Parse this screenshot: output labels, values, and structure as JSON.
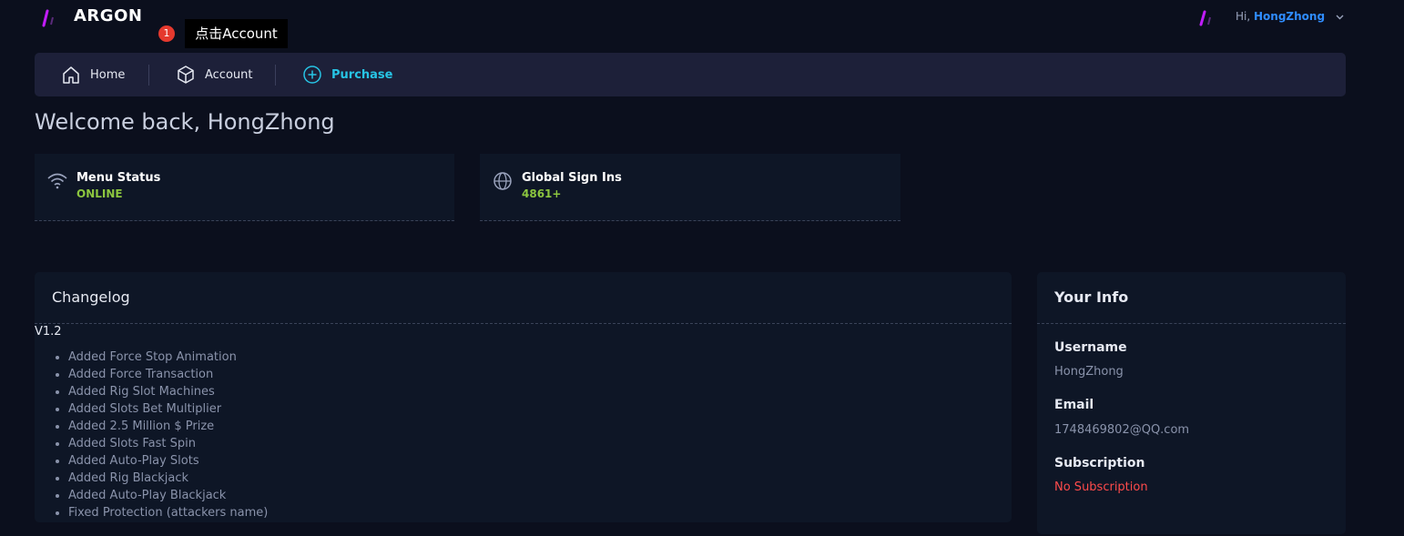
{
  "app": {
    "brand": "ARGON"
  },
  "annotation": {
    "step": "1",
    "text": "点击Account"
  },
  "user": {
    "greeting": "Hi,",
    "name": "HongZhong"
  },
  "nav": {
    "items": [
      {
        "label": "Home",
        "icon": "home-icon"
      },
      {
        "label": "Account",
        "icon": "cube-icon"
      },
      {
        "label": "Purchase",
        "icon": "plus-circle-icon",
        "active": true
      }
    ]
  },
  "welcome": "Welcome back, HongZhong",
  "stats": [
    {
      "title": "Menu Status",
      "value": "ONLINE",
      "icon": "wifi-icon"
    },
    {
      "title": "Global Sign Ins",
      "value": "4861+",
      "icon": "globe-icon"
    }
  ],
  "changelog": {
    "title": "Changelog",
    "version": "V1.2",
    "entries": [
      "Added Force Stop Animation",
      "Added Force Transaction",
      "Added Rig Slot Machines",
      "Added Slots Bet Multiplier",
      "Added 2.5 Million $ Prize",
      "Added Slots Fast Spin",
      "Added Auto-Play Slots",
      "Added Rig Blackjack",
      "Added Auto-Play Blackjack",
      "Fixed Protection (attackers name)"
    ]
  },
  "info": {
    "title": "Your Info",
    "username_label": "Username",
    "username": "HongZhong",
    "email_label": "Email",
    "email": "1748469802@QQ.com",
    "subscription_label": "Subscription",
    "subscription": "No Subscription"
  },
  "colors": {
    "background": "#0b0f1d",
    "nav": "#1d2039",
    "card": "#0e1626",
    "accent": "#27c4e5",
    "online": "#8cc63f",
    "danger": "#ff4b4b",
    "link": "#2f8cff",
    "logo": "#c21cff"
  }
}
